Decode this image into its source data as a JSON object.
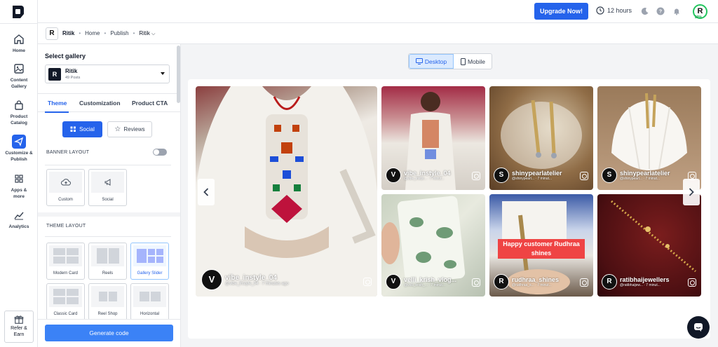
{
  "rail": {
    "items": [
      {
        "label": "Home",
        "icon": "home-icon"
      },
      {
        "label": "Content Gallery",
        "icon": "image-icon"
      },
      {
        "label": "Product Catalog",
        "icon": "bag-icon"
      },
      {
        "label": "Customize & Publish",
        "icon": "send-icon"
      },
      {
        "label": "Apps & more",
        "icon": "grid-icon"
      },
      {
        "label": "Analytics",
        "icon": "chart-icon"
      }
    ],
    "refer_label": "Refer & Earn"
  },
  "topbar": {
    "upgrade_label": "Upgrade Now!",
    "hours_label": "12 hours",
    "avatar_letter": "R",
    "avatar_percent": "20%"
  },
  "breadcrumb": {
    "badge": "R",
    "items": [
      "Ritik",
      "Home",
      "Publish",
      "Ritik"
    ]
  },
  "panel": {
    "select_gallery_title": "Select gallery",
    "gallery": {
      "letter": "R",
      "name": "Ritik",
      "count": "49 Posts"
    },
    "tabs": [
      "Theme",
      "Customization",
      "Product CTA"
    ],
    "source_buttons": {
      "social": "Social",
      "reviews": "Reviews"
    },
    "banner_layout_label": "BANNER LAYOUT",
    "banner_options": [
      "Custom",
      "Social"
    ],
    "theme_layout_label": "THEME LAYOUT",
    "theme_options": [
      "Modern Card",
      "Reels",
      "Gallery Slider",
      "Classic Card",
      "Reel Shop",
      "Horizontal"
    ],
    "generate_label": "Generate code"
  },
  "preview": {
    "device_desktop": "Desktop",
    "device_mobile": "Mobile",
    "tiles": [
      {
        "letter": "V",
        "username": "vibe_instyle_04",
        "meta": "@vibe_instyle_04 · 7 minutes ago"
      },
      {
        "letter": "V",
        "username": "vibe_instyle_04",
        "meta": "@vibe_instyl... · 7 minut..."
      },
      {
        "letter": "S",
        "username": "shinypearlatelier",
        "meta": "@shinypearl... · 7 minut..."
      },
      {
        "letter": "S",
        "username": "shinypearlatelier",
        "meta": "@shinypearl... · 7 minut..."
      },
      {
        "letter": "V",
        "username": "velli_krish_vlog...",
        "meta": "@velli_krish_... · 7 minut..."
      },
      {
        "letter": "R",
        "username": "rudhraa_shines",
        "meta": "@rudhraa_s... · 7 minut...",
        "overlay": "Happy customer Rudhraa shines"
      },
      {
        "letter": "R",
        "username": "ratibhaijewellers",
        "meta": "@ratibhaijew... · 7 minut..."
      }
    ]
  },
  "colors": {
    "accent": "#2563eb",
    "panel_bg": "#f3f4f6"
  }
}
